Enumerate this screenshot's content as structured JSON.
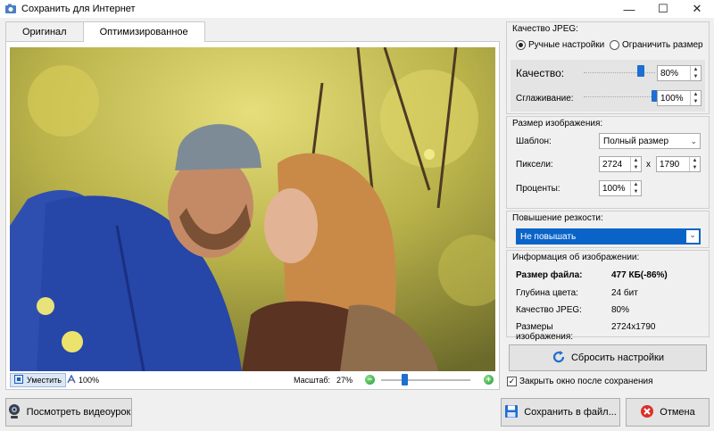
{
  "window": {
    "title": "Сохранить для Интернет"
  },
  "tabs": [
    {
      "label": "Оригинал"
    },
    {
      "label": "Оптимизированное"
    }
  ],
  "preview": {
    "fit_label": "Уместить",
    "zoom_label": "100%",
    "scale_label": "Масштаб:",
    "scale_value": "27%",
    "scale_fraction": 0.27
  },
  "jpeg": {
    "group_label": "Качество JPEG:",
    "radio_manual": "Ручные настройки",
    "radio_limit": "Ограничить размер",
    "quality_label": "Качество:",
    "quality_value": "80%",
    "quality_level": 0.8,
    "smoothing_label": "Сглаживание:",
    "smoothing_value": "100%",
    "smoothing_level": 1.0
  },
  "size": {
    "group_label": "Размер изображения:",
    "template_label": "Шаблон:",
    "template_value": "Полный размер",
    "pixels_label": "Пиксели:",
    "width": "2724",
    "times": "x",
    "height": "1790",
    "percent_label": "Проценты:",
    "percent_value": "100%"
  },
  "sharpen": {
    "group_label": "Повышение резкости:",
    "value": "Не повышать"
  },
  "info": {
    "group_label": "Информация об изображении:",
    "rows": [
      {
        "k": "Размер файла:",
        "v": "477 КБ(-86%)"
      },
      {
        "k": "Глубина цвета:",
        "v": "24 бит"
      },
      {
        "k": "Качество JPEG:",
        "v": "80%"
      },
      {
        "k": "Размеры изображения:",
        "v": "2724x1790"
      }
    ]
  },
  "actions": {
    "reset": "Сбросить настройки",
    "close_after_save": "Закрыть окно после сохранения",
    "video": "Посмотреть видеоурок",
    "save": "Сохранить в файл...",
    "cancel": "Отмена"
  },
  "colors": {
    "accent": "#1e6fd0",
    "selection": "#0a64c8"
  },
  "icons": [
    "app-icon",
    "fit-icon",
    "zoom-icon",
    "reset-icon",
    "webcam-icon",
    "floppy-icon",
    "cancel-icon"
  ]
}
